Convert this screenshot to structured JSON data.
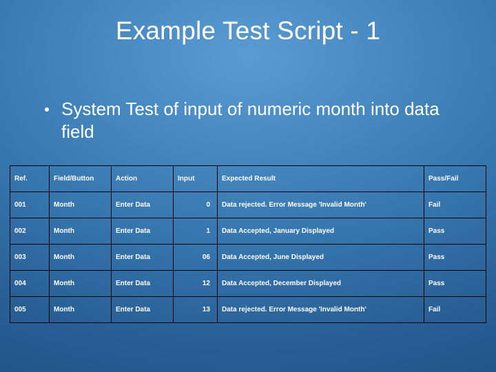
{
  "title": "Example Test Script - 1",
  "bullet": "System Test of input of numeric month into data field",
  "table": {
    "headers": {
      "ref": "Ref.",
      "field_button": "Field/Button",
      "action": "Action",
      "input": "Input",
      "expected_result": "Expected Result",
      "pass_fail": "Pass/Fail"
    },
    "rows": [
      {
        "ref": "001",
        "field_button": "Month",
        "action": "Enter Data",
        "input": "0",
        "expected_result": "Data rejected. Error Message 'Invalid Month'",
        "pass_fail": "Fail"
      },
      {
        "ref": "002",
        "field_button": "Month",
        "action": "Enter Data",
        "input": "1",
        "expected_result": "Data Accepted, January Displayed",
        "pass_fail": "Pass"
      },
      {
        "ref": "003",
        "field_button": "Month",
        "action": "Enter Data",
        "input": "06",
        "expected_result": "Data Accepted, June Displayed",
        "pass_fail": "Pass"
      },
      {
        "ref": "004",
        "field_button": "Month",
        "action": "Enter Data",
        "input": "12",
        "expected_result": "Data Accepted, December Displayed",
        "pass_fail": "Pass"
      },
      {
        "ref": "005",
        "field_button": "Month",
        "action": "Enter Data",
        "input": "13",
        "expected_result": "Data rejected. Error Message 'Invalid Month'",
        "pass_fail": "Fail"
      }
    ]
  }
}
